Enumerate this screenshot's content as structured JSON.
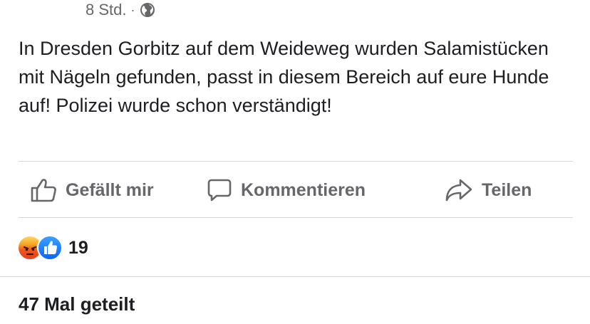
{
  "post": {
    "time": "8 Std.",
    "separator": "·",
    "audience_icon": "globe-icon",
    "text": "In Dresden Gorbitz auf dem Weideweg wurden Salamistücken mit Nägeln gefunden, passt in diesem Bereich auf eure Hunde auf! Polizei wurde schon verständigt!"
  },
  "actions": {
    "like": {
      "label": "Gefällt mir",
      "icon": "thumbs-up-icon"
    },
    "comment": {
      "label": "Kommentieren",
      "icon": "comment-icon"
    },
    "share": {
      "label": "Teilen",
      "icon": "share-arrow-icon"
    }
  },
  "reactions": {
    "types": [
      "angry",
      "like"
    ],
    "count": "19"
  },
  "shares": {
    "label": "47 Mal geteilt"
  },
  "colors": {
    "text": "#1c1e21",
    "secondary": "#65676b",
    "divider": "#d7d8db",
    "like_blue": "#0866ff",
    "angry_orange": "#f0541e"
  }
}
